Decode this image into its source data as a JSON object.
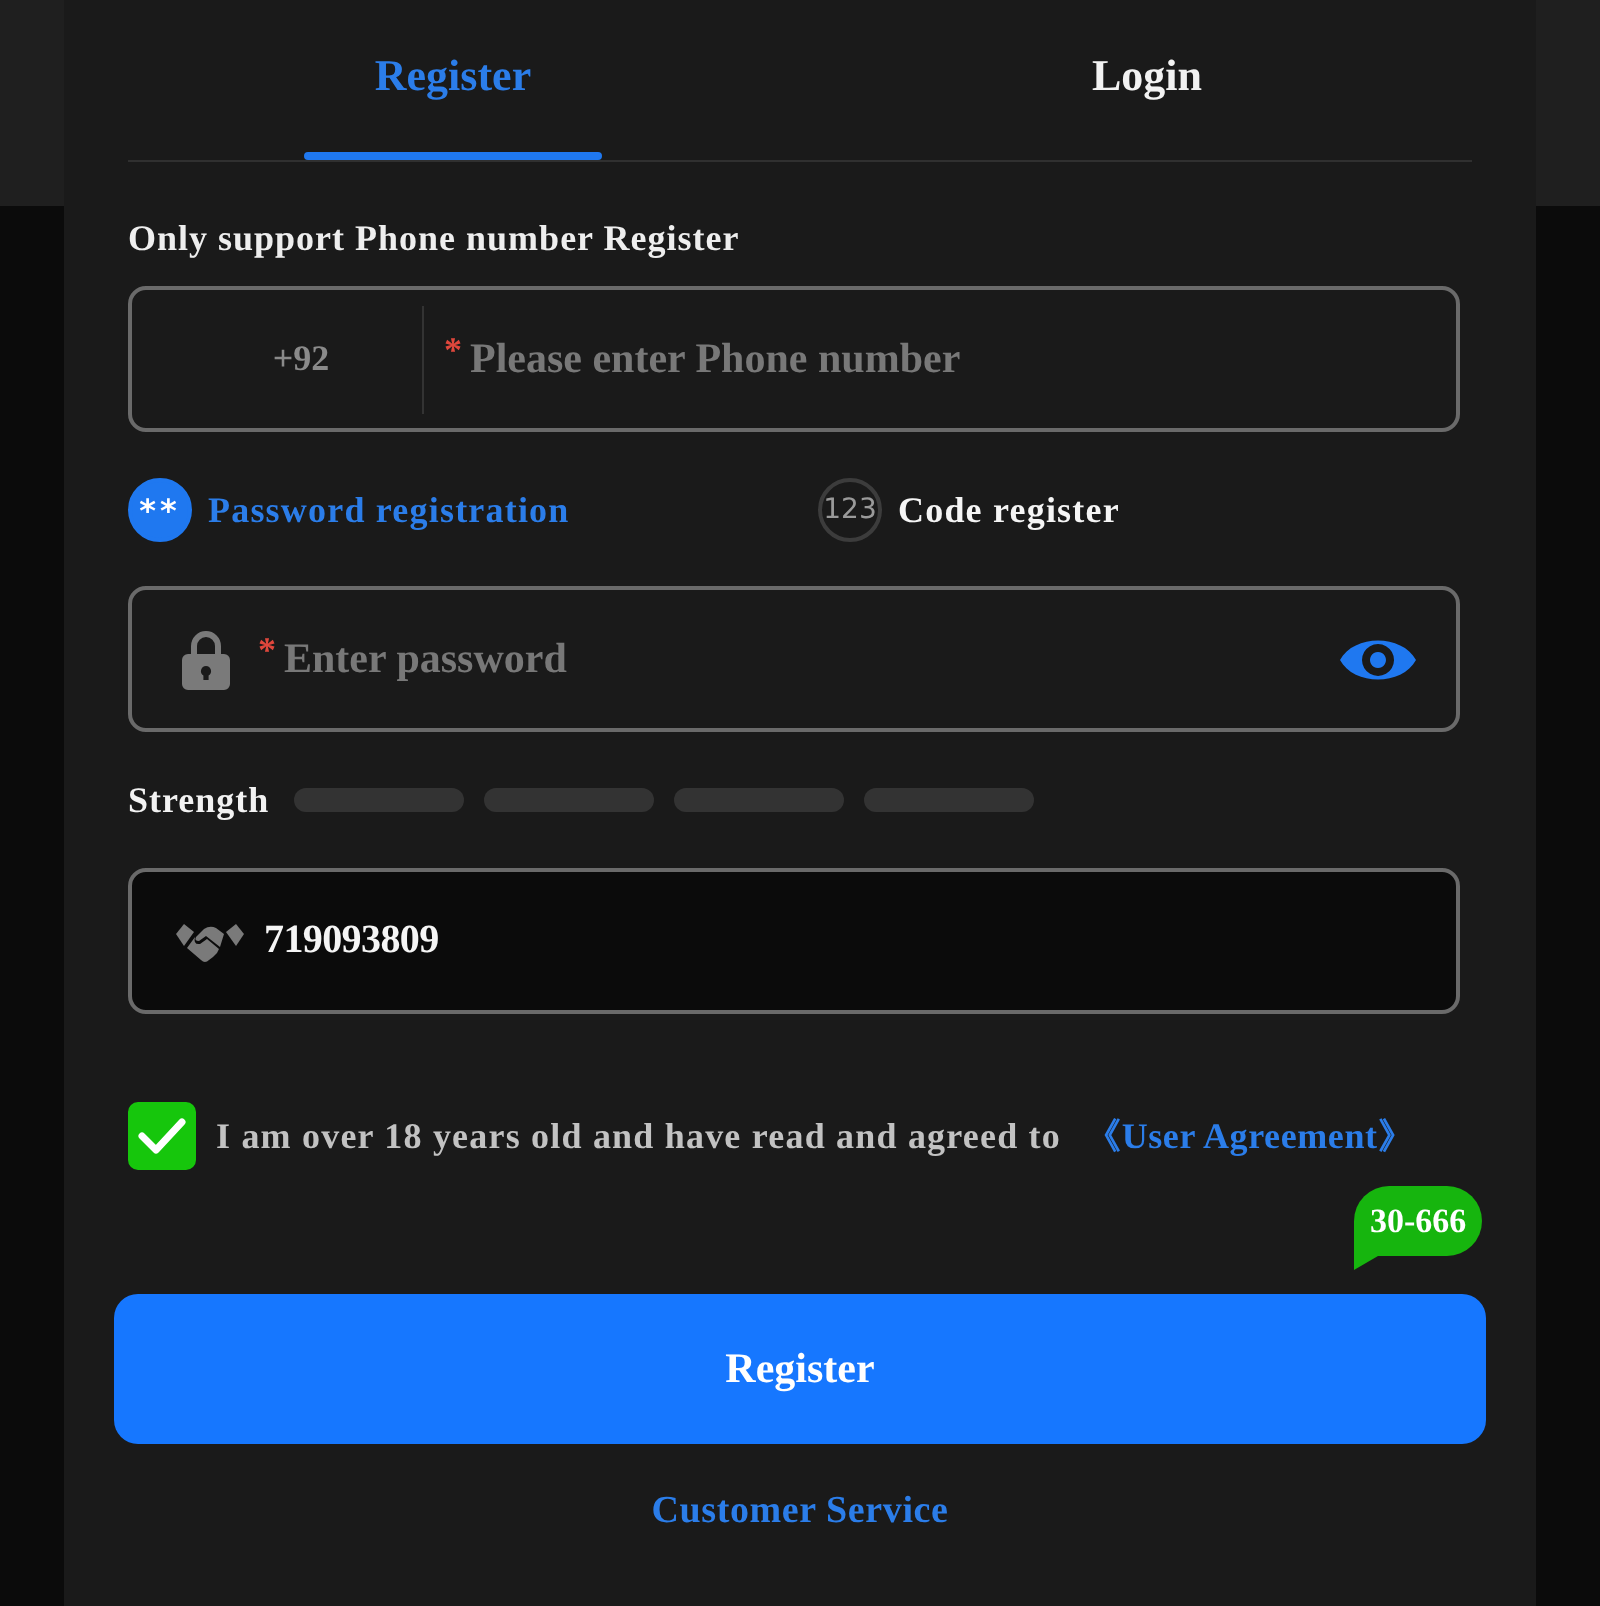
{
  "tabs": [
    {
      "label": "Register",
      "selected": true
    },
    {
      "label": "Login",
      "selected": false
    }
  ],
  "notice": "Only support Phone number Register",
  "phone_field": {
    "prefix": "+92",
    "required_mark": "*",
    "placeholder": "Please enter Phone number"
  },
  "methods": [
    {
      "icon_text": "**",
      "label": "Password registration",
      "selected": true
    },
    {
      "icon_text": "123",
      "label": "Code register",
      "selected": false
    }
  ],
  "password_field": {
    "required_mark": "*",
    "placeholder": "Enter password"
  },
  "strength": {
    "label": "Strength",
    "segments": [
      {
        "filled": false
      },
      {
        "filled": false
      },
      {
        "filled": false
      },
      {
        "filled": false
      }
    ]
  },
  "invite_field": {
    "value": "719093809"
  },
  "agreement": {
    "checked": true,
    "text": "I am over 18 years old and have read and agreed to",
    "link": "《User Agreement》"
  },
  "bubble": "30-666",
  "submit_button": "Register",
  "footer_link": "Customer Service"
}
